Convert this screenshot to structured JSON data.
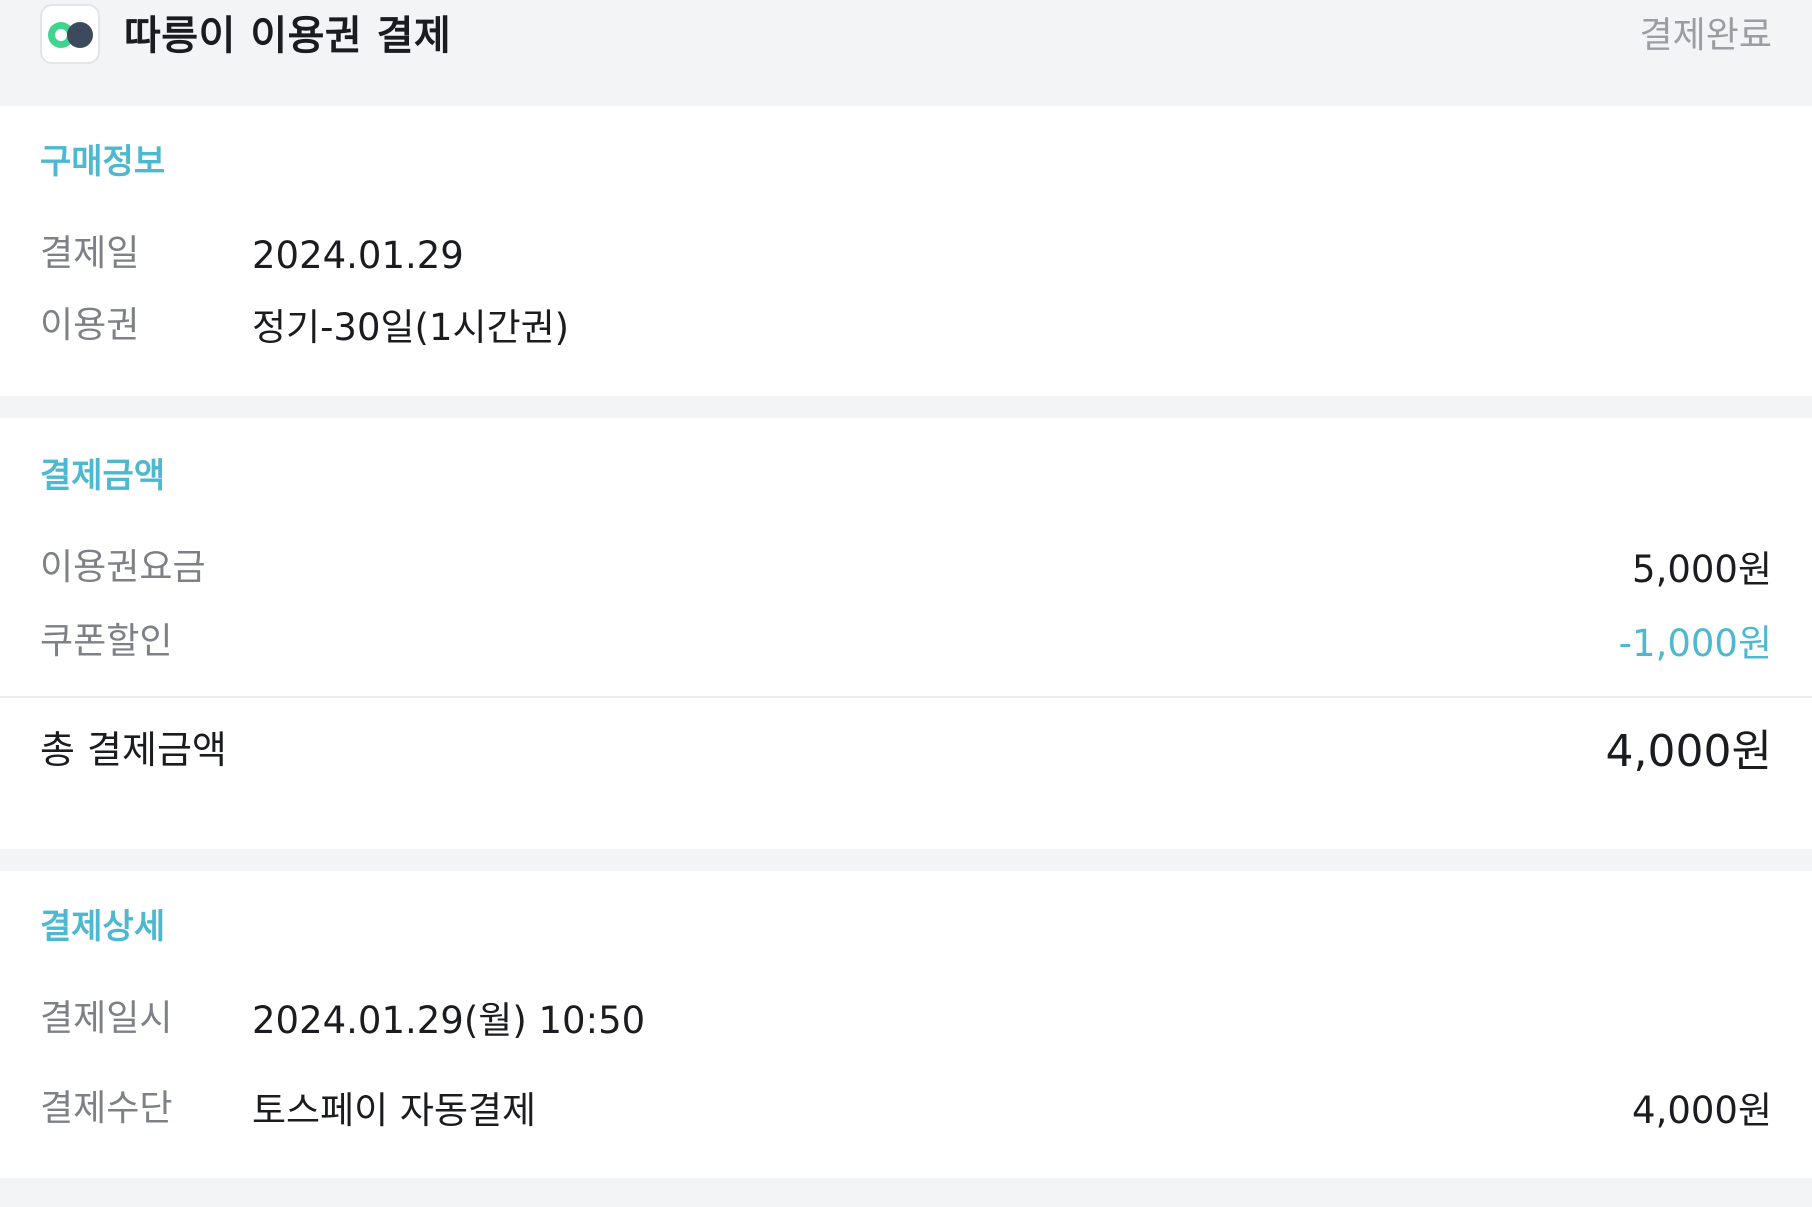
{
  "header": {
    "icon": "ttareungi-logo-icon",
    "title": "따릉이 이용권 결제",
    "status": "결제완료"
  },
  "purchase_info": {
    "title": "구매정보",
    "payment_date_label": "결제일",
    "payment_date_value": "2024.01.29",
    "pass_label": "이용권",
    "pass_value": "정기-30일(1시간권)"
  },
  "payment_amount": {
    "title": "결제금액",
    "pass_fee_label": "이용권요금",
    "pass_fee_value": "5,000원",
    "coupon_label": "쿠폰할인",
    "coupon_value": "-1,000원",
    "total_label": "총 결제금액",
    "total_value": "4,000원"
  },
  "payment_detail": {
    "title": "결제상세",
    "datetime_label": "결제일시",
    "datetime_value": "2024.01.29(월) 10:50",
    "method_label": "결제수단",
    "method_value": "토스페이 자동결제",
    "method_amount": "4,000원"
  },
  "colors": {
    "accent": "#4db8cf",
    "logo_green": "#3fd58f",
    "logo_dark": "#3c4a5c",
    "background": "#f3f4f6"
  }
}
